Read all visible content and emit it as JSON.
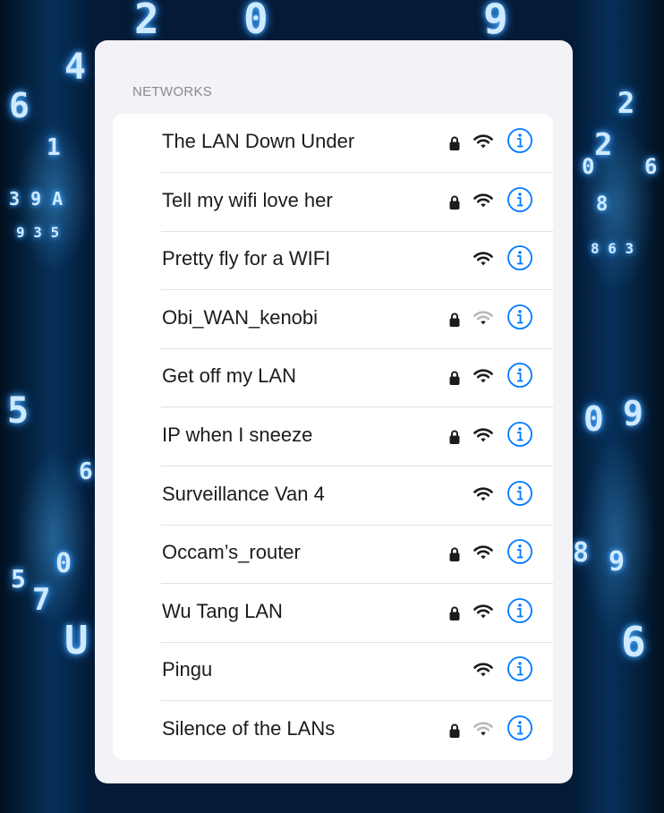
{
  "section_header": "NETWORKS",
  "networks": [
    {
      "name": "The LAN Down Under",
      "locked": true,
      "signal": "full"
    },
    {
      "name": "Tell my wifi love her",
      "locked": true,
      "signal": "full"
    },
    {
      "name": "Pretty fly for a WIFI",
      "locked": false,
      "signal": "full"
    },
    {
      "name": "Obi_WAN_kenobi",
      "locked": true,
      "signal": "weak"
    },
    {
      "name": "Get off my LAN",
      "locked": true,
      "signal": "full"
    },
    {
      "name": "IP when I sneeze",
      "locked": true,
      "signal": "full"
    },
    {
      "name": "Surveillance Van 4",
      "locked": false,
      "signal": "full"
    },
    {
      "name": "Occam’s_router",
      "locked": true,
      "signal": "full"
    },
    {
      "name": "Wu Tang LAN",
      "locked": true,
      "signal": "full"
    },
    {
      "name": "Pingu",
      "locked": false,
      "signal": "full"
    },
    {
      "name": "Silence of the LANs",
      "locked": true,
      "signal": "weak"
    }
  ],
  "icons": {
    "lock": "lock-icon",
    "wifi": "wifi-icon",
    "info": "info-icon"
  },
  "colors": {
    "accent": "#007aff",
    "icon_dark": "#1c1c1e",
    "wifi_dim": "#b8b8bd"
  }
}
